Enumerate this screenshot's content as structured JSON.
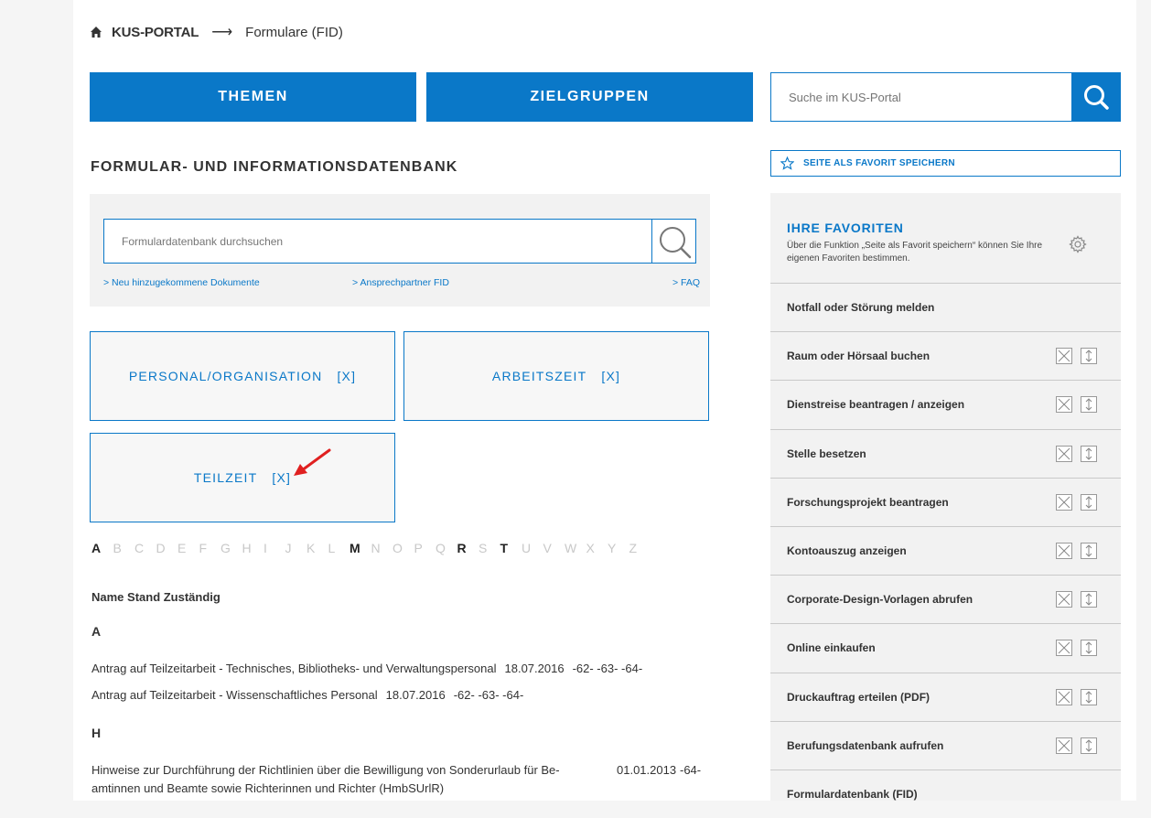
{
  "breadcrumb": {
    "home_label": "KUS-PORTAL",
    "separator": "⟶",
    "current": "Formulare (FID)"
  },
  "nav": {
    "themen": "THEMEN",
    "zielgruppen": "ZIELGRUPPEN"
  },
  "portal_search": {
    "placeholder": "Suche im KUS-Portal"
  },
  "favorite_save": "SEITE ALS FAVORIT SPEICHERN",
  "section_title": "FORMULAR- UND INFORMATIONSDATENBANK",
  "db_search": {
    "placeholder": "Formulardatenbank durchsuchen"
  },
  "db_links": {
    "new_docs": "> Neu hinzugekommene Dokumente",
    "contact": "> Ansprechpartner FID",
    "faq": "> FAQ"
  },
  "filters": [
    {
      "label": "PERSONAL/ORGANISATION",
      "remove": "[X]"
    },
    {
      "label": "ARBEITSZEIT",
      "remove": "[X]"
    },
    {
      "label": "TEILZEIT",
      "remove": "[X]"
    }
  ],
  "alphabet": [
    {
      "l": "A",
      "on": true
    },
    {
      "l": "B",
      "on": false
    },
    {
      "l": "C",
      "on": false
    },
    {
      "l": "D",
      "on": false
    },
    {
      "l": "E",
      "on": false
    },
    {
      "l": "F",
      "on": false
    },
    {
      "l": "G",
      "on": false
    },
    {
      "l": "H",
      "on": false
    },
    {
      "l": "I",
      "on": false
    },
    {
      "l": "J",
      "on": false
    },
    {
      "l": "K",
      "on": false
    },
    {
      "l": "L",
      "on": false
    },
    {
      "l": "M",
      "on": true
    },
    {
      "l": "N",
      "on": false
    },
    {
      "l": "O",
      "on": false
    },
    {
      "l": "P",
      "on": false
    },
    {
      "l": "Q",
      "on": false
    },
    {
      "l": "R",
      "on": true
    },
    {
      "l": "S",
      "on": false
    },
    {
      "l": "T",
      "on": true
    },
    {
      "l": "U",
      "on": false
    },
    {
      "l": "V",
      "on": false
    },
    {
      "l": "W",
      "on": false
    },
    {
      "l": "X",
      "on": false
    },
    {
      "l": "Y",
      "on": false
    },
    {
      "l": "Z",
      "on": false
    }
  ],
  "table": {
    "header": "Name Stand Zuständig",
    "groups": [
      {
        "letter": "A",
        "rows": [
          {
            "name": "Antrag auf Teilzeitarbeit - Technisches, Bibliotheks- und Verwaltungspersonal",
            "date": "18.07.2016",
            "resp": "-62- -63- -64-"
          },
          {
            "name": "Antrag auf Teilzeitarbeit - Wissenschaftliches Personal",
            "date": "18.07.2016",
            "resp": "-62- -63- -64-"
          }
        ]
      },
      {
        "letter": "H",
        "rows": [
          {
            "name_line1": "Hinweise zur Durchführung der Richtlinien über die Bewilligung von Sonderurlaub für Be-",
            "name_line2": "amtinnen und Beamte sowie Richterinnen und Richter (HmbSUrlR)",
            "date": "01.01.2013",
            "resp": "-64-"
          }
        ]
      }
    ]
  },
  "favorites": {
    "title": "IHRE FAVORITEN",
    "description": "Über die Funktion „Seite als Favorit speichern“ können Sie Ihre eigenen Favoriten bestimmen.",
    "items": [
      "Notfall oder Störung melden",
      "Raum oder Hörsaal buchen",
      "Dienstreise beantragen / anzeigen",
      "Stelle besetzen",
      "Forschungsprojekt beantragen",
      "Kontoauszug anzeigen",
      "Corporate-Design-Vorlagen abrufen",
      "Online einkaufen",
      "Druckauftrag erteilen (PDF)",
      "Berufungsdatenbank aufrufen",
      "Formulardatenbank (FID)"
    ]
  },
  "colors": {
    "accent": "#0a78c8",
    "annotation_arrow": "#e02020"
  }
}
